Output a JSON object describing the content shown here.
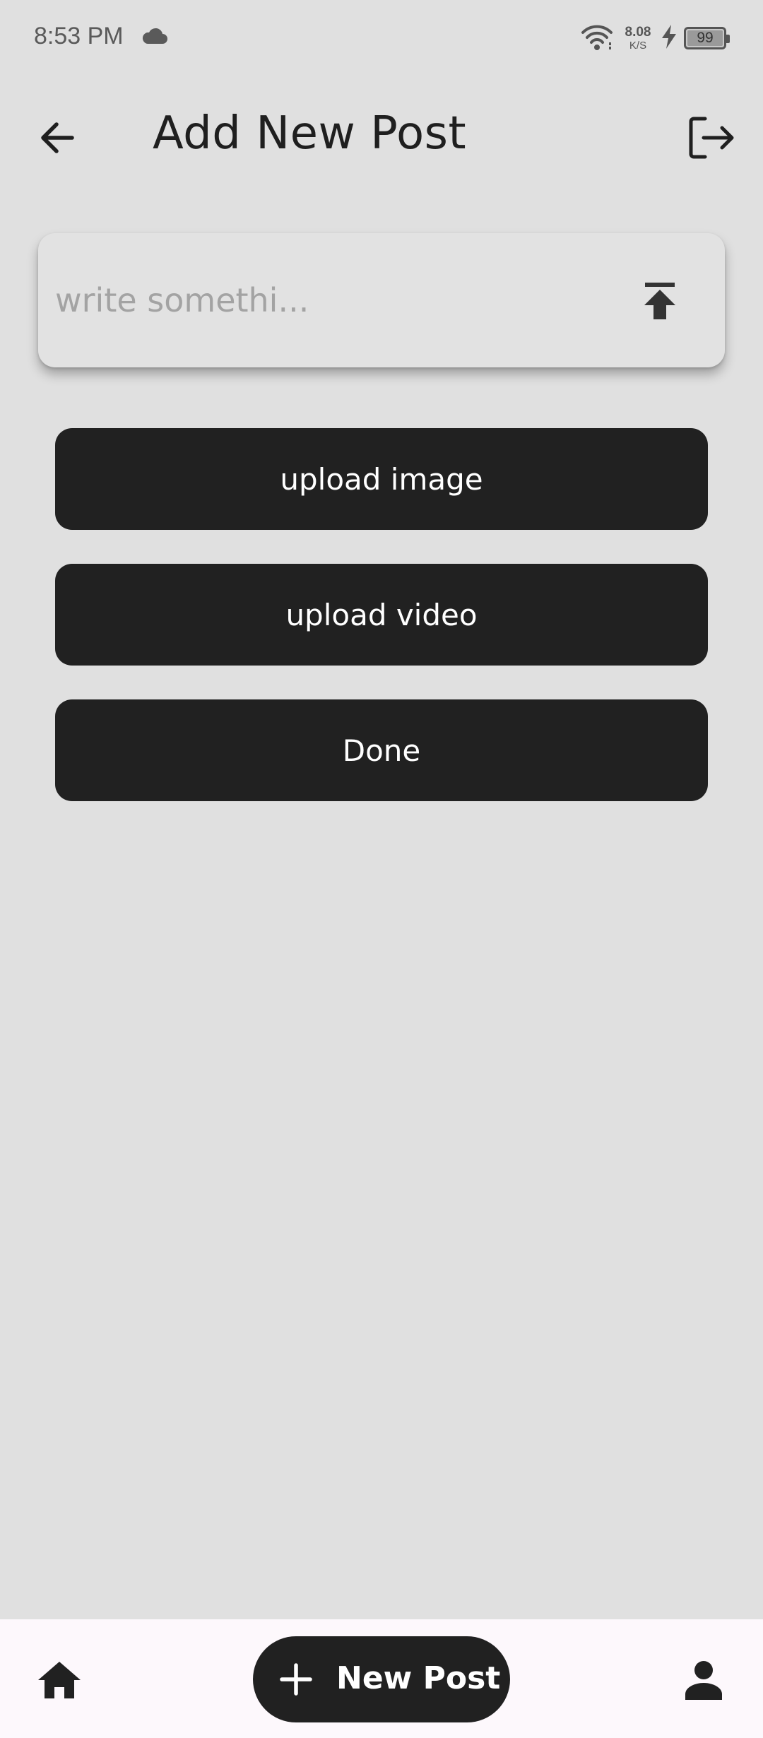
{
  "status_bar": {
    "time": "8:53 PM",
    "cloud_icon": "cloud-icon",
    "wifi_icon": "wifi-icon",
    "net_speed_value": "8.08",
    "net_speed_unit": "K/S",
    "charging_icon": "charging-bolt-icon",
    "battery_level": "99"
  },
  "app_bar": {
    "back_icon": "arrow-back-icon",
    "title": "Add New Post",
    "logout_icon": "logout-icon"
  },
  "post_input": {
    "placeholder": "write somethi...",
    "value": "",
    "upload_icon": "upload-icon"
  },
  "actions": {
    "upload_image_label": "upload image",
    "upload_video_label": "upload video",
    "done_label": "Done"
  },
  "bottom_nav": {
    "home_icon": "home-icon",
    "new_post_icon": "plus-icon",
    "new_post_label": "New Post",
    "profile_icon": "person-icon"
  },
  "colors": {
    "background": "#e0e0e0",
    "button": "#212121",
    "button_text": "#ffffff",
    "nav_background": "#fdf8fc",
    "placeholder": "#a3a3a3"
  }
}
